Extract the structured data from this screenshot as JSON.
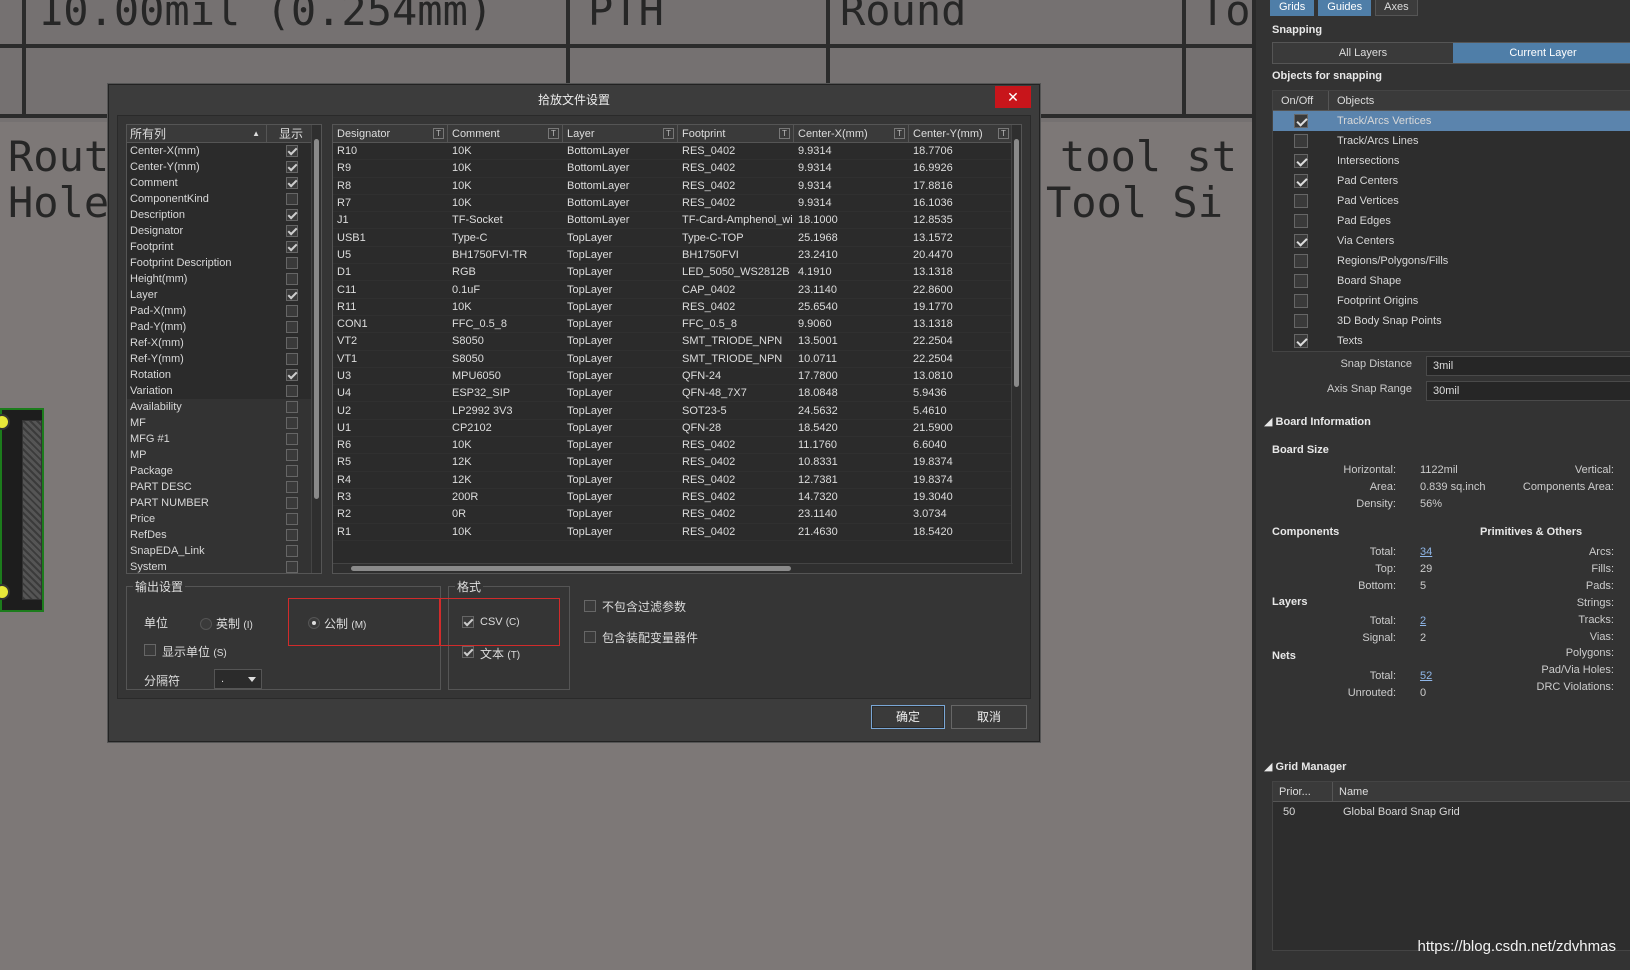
{
  "canvas": {
    "top_strip": [
      "10.00mil (0.254mm)",
      "PTH",
      "Round",
      "To"
    ],
    "row2_left": [
      "Rout",
      "Hole"
    ],
    "row2_right": [
      "tool st",
      "Tool Si"
    ]
  },
  "dialog": {
    "title": "拾放文件设置",
    "close_symbol": "✕",
    "columns_list": {
      "header_name": "所有列",
      "header_show": "显示",
      "items": [
        {
          "label": "Center-X(mm)",
          "checked": true
        },
        {
          "label": "Center-Y(mm)",
          "checked": true
        },
        {
          "label": "Comment",
          "checked": true
        },
        {
          "label": "ComponentKind",
          "checked": false
        },
        {
          "label": "Description",
          "checked": true
        },
        {
          "label": "Designator",
          "checked": true
        },
        {
          "label": "Footprint",
          "checked": true
        },
        {
          "label": "Footprint Description",
          "checked": false
        },
        {
          "label": "Height(mm)",
          "checked": false
        },
        {
          "label": "Layer",
          "checked": true
        },
        {
          "label": "Pad-X(mm)",
          "checked": false
        },
        {
          "label": "Pad-Y(mm)",
          "checked": false
        },
        {
          "label": "Ref-X(mm)",
          "checked": false
        },
        {
          "label": "Ref-Y(mm)",
          "checked": false
        },
        {
          "label": "Rotation",
          "checked": true
        },
        {
          "label": "Variation",
          "checked": false
        },
        {
          "label": "Availability",
          "checked": false
        },
        {
          "label": "MF",
          "checked": false
        },
        {
          "label": "MFG #1",
          "checked": false
        },
        {
          "label": "MP",
          "checked": false
        },
        {
          "label": "Package",
          "checked": false
        },
        {
          "label": "PART DESC",
          "checked": false
        },
        {
          "label": "PART NUMBER",
          "checked": false
        },
        {
          "label": "Price",
          "checked": false
        },
        {
          "label": "RefDes",
          "checked": false
        },
        {
          "label": "SnapEDA_Link",
          "checked": false
        },
        {
          "label": "System",
          "checked": false
        }
      ]
    },
    "table": {
      "headers": [
        "Designator",
        "Comment",
        "Layer",
        "Footprint",
        "Center-X(mm)",
        "Center-Y(mm)"
      ],
      "filter_symbol": "T",
      "rows": [
        [
          "R10",
          "10K",
          "BottomLayer",
          "RES_0402",
          "9.9314",
          "18.7706"
        ],
        [
          "R9",
          "10K",
          "BottomLayer",
          "RES_0402",
          "9.9314",
          "16.9926"
        ],
        [
          "R8",
          "10K",
          "BottomLayer",
          "RES_0402",
          "9.9314",
          "17.8816"
        ],
        [
          "R7",
          "10K",
          "BottomLayer",
          "RES_0402",
          "9.9314",
          "16.1036"
        ],
        [
          "J1",
          "TF-Socket",
          "BottomLayer",
          "TF-Card-Amphenol_wi",
          "18.1000",
          "12.8535"
        ],
        [
          "USB1",
          "Type-C",
          "TopLayer",
          "Type-C-TOP",
          "25.1968",
          "13.1572"
        ],
        [
          "U5",
          "BH1750FVI-TR",
          "TopLayer",
          "BH1750FVI",
          "23.2410",
          "20.4470"
        ],
        [
          "D1",
          "RGB",
          "TopLayer",
          "LED_5050_WS2812B",
          "4.1910",
          "13.1318"
        ],
        [
          "C11",
          "0.1uF",
          "TopLayer",
          "CAP_0402",
          "23.1140",
          "22.8600"
        ],
        [
          "R11",
          "10K",
          "TopLayer",
          "RES_0402",
          "25.6540",
          "19.1770"
        ],
        [
          "CON1",
          "FFC_0.5_8",
          "TopLayer",
          "FFC_0.5_8",
          "9.9060",
          "13.1318"
        ],
        [
          "VT2",
          "S8050",
          "TopLayer",
          "SMT_TRIODE_NPN",
          "13.5001",
          "22.2504"
        ],
        [
          "VT1",
          "S8050",
          "TopLayer",
          "SMT_TRIODE_NPN",
          "10.0711",
          "22.2504"
        ],
        [
          "U3",
          "MPU6050",
          "TopLayer",
          "QFN-24",
          "17.7800",
          "13.0810"
        ],
        [
          "U4",
          "ESP32_SIP",
          "TopLayer",
          "QFN-48_7X7",
          "18.0848",
          "5.9436"
        ],
        [
          "U2",
          "LP2992 3V3",
          "TopLayer",
          "SOT23-5",
          "24.5632",
          "5.4610"
        ],
        [
          "U1",
          "CP2102",
          "TopLayer",
          "QFN-28",
          "18.5420",
          "21.5900"
        ],
        [
          "R6",
          "10K",
          "TopLayer",
          "RES_0402",
          "11.1760",
          "6.6040"
        ],
        [
          "R5",
          "12K",
          "TopLayer",
          "RES_0402",
          "10.8331",
          "19.8374"
        ],
        [
          "R4",
          "12K",
          "TopLayer",
          "RES_0402",
          "12.7381",
          "19.8374"
        ],
        [
          "R3",
          "200R",
          "TopLayer",
          "RES_0402",
          "14.7320",
          "19.3040"
        ],
        [
          "R2",
          "0R",
          "TopLayer",
          "RES_0402",
          "23.1140",
          "3.0734"
        ],
        [
          "R1",
          "10K",
          "TopLayer",
          "RES_0402",
          "21.4630",
          "18.5420"
        ]
      ]
    },
    "output": {
      "group_title": "输出设置",
      "unit_label": "单位",
      "imperial": "英制",
      "imperial_hotkey": "(I)",
      "metric": "公制",
      "metric_hotkey": "(M)",
      "unit_selected": "metric",
      "show_units": "显示单位",
      "show_units_hotkey": "(S)",
      "show_units_checked": false,
      "separator_label": "分隔符",
      "separator_value": "."
    },
    "format": {
      "group_title": "格式",
      "csv": "CSV",
      "csv_hotkey": "(C)",
      "csv_checked": true,
      "text": "文本",
      "text_hotkey": "(T)",
      "text_checked": true
    },
    "options": {
      "exclude_filter": "不包含过滤参数",
      "exclude_filter_checked": false,
      "include_variant": "包含装配变量器件",
      "include_variant_checked": false
    },
    "ok": "确定",
    "cancel": "取消"
  },
  "panel": {
    "tabs": [
      "Grids",
      "Guides",
      "Axes"
    ],
    "snapping_title": "Snapping",
    "snap_modes": [
      "All Layers",
      "Current Layer"
    ],
    "objects_title": "Objects for snapping",
    "objects_header": [
      "On/Off",
      "Objects"
    ],
    "objects": [
      {
        "label": "Track/Arcs Vertices",
        "on": true,
        "selected": true
      },
      {
        "label": "Track/Arcs Lines",
        "on": false
      },
      {
        "label": "Intersections",
        "on": true
      },
      {
        "label": "Pad Centers",
        "on": true
      },
      {
        "label": "Pad Vertices",
        "on": false
      },
      {
        "label": "Pad Edges",
        "on": false
      },
      {
        "label": "Via Centers",
        "on": true
      },
      {
        "label": "Regions/Polygons/Fills",
        "on": false
      },
      {
        "label": "Board Shape",
        "on": false
      },
      {
        "label": "Footprint Origins",
        "on": false
      },
      {
        "label": "3D Body Snap Points",
        "on": false
      },
      {
        "label": "Texts",
        "on": true
      }
    ],
    "snap_distance_label": "Snap Distance",
    "snap_distance_value": "3mil",
    "axis_snap_label": "Axis Snap Range",
    "axis_snap_value": "30mil",
    "board_info_title": "Board Information",
    "board_size_title": "Board Size",
    "horizontal_label": "Horizontal:",
    "horizontal_value": "1122mil",
    "vertical_label": "Vertical:",
    "area_label": "Area:",
    "area_value": "0.839 sq.inch",
    "components_area_label": "Components Area:",
    "density_label": "Density:",
    "density_value": "56%",
    "components_title": "Components",
    "primitives_title": "Primitives & Others",
    "total_label": "Total:",
    "comp_total": "34",
    "top_label": "Top:",
    "comp_top": "29",
    "bottom_label": "Bottom:",
    "comp_bottom": "5",
    "layers_title": "Layers",
    "layers_total": "2",
    "signal_label": "Signal:",
    "layers_signal": "2",
    "nets_title": "Nets",
    "nets_total": "52",
    "unrouted_label": "Unrouted:",
    "nets_unrouted": "0",
    "primitives": [
      "Arcs:",
      "Fills:",
      "Pads:",
      "Strings:",
      "Tracks:",
      "Vias:",
      "Polygons:",
      "Pad/Via Holes:",
      "DRC Violations:"
    ],
    "grid_manager_title": "Grid Manager",
    "grid_header": [
      "Prior...",
      "Name"
    ],
    "grid_rows": [
      [
        "50",
        "Global Board Snap Grid"
      ]
    ]
  },
  "watermark": "https://blog.csdn.net/zdvhmas"
}
